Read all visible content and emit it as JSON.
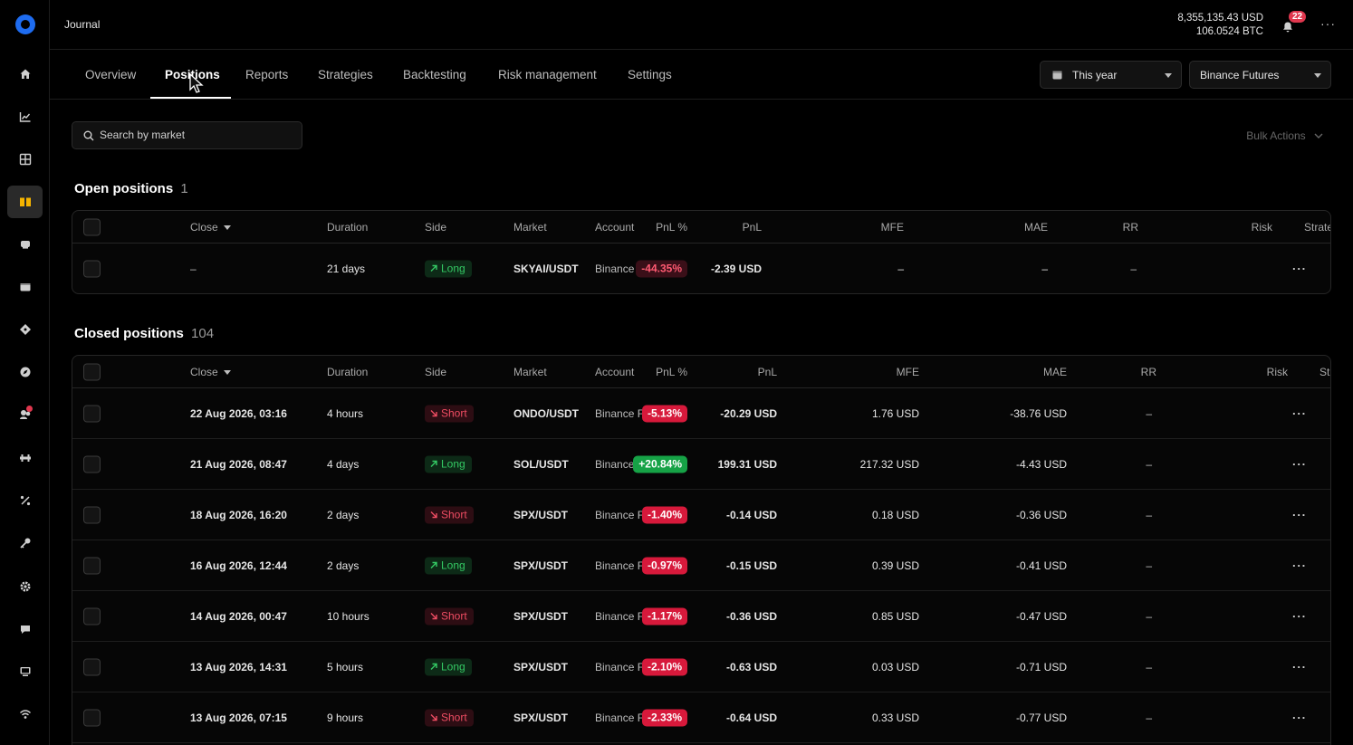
{
  "app": {
    "title": "Journal"
  },
  "balances": {
    "usd": "8,355,135.43 USD",
    "btc": "106.0524 BTC"
  },
  "notifications": {
    "count": "22"
  },
  "sidebar": {
    "items": [
      {
        "icon": "home-icon"
      },
      {
        "icon": "chart-icon"
      },
      {
        "icon": "grid-icon"
      },
      {
        "icon": "journal-icon",
        "active": true
      },
      {
        "icon": "trading-icon"
      },
      {
        "icon": "wallet-icon"
      },
      {
        "icon": "tag-icon"
      },
      {
        "icon": "compass-icon"
      },
      {
        "icon": "community-icon",
        "dot": true
      },
      {
        "icon": "bridge-icon"
      },
      {
        "icon": "percent-icon"
      },
      {
        "icon": "key-icon"
      },
      {
        "icon": "settings-icon"
      },
      {
        "icon": "chat-icon"
      },
      {
        "icon": "monitor-icon"
      },
      {
        "icon": "wifi-icon"
      }
    ]
  },
  "tabs": [
    "Overview",
    "Positions",
    "Reports",
    "Strategies",
    "Backtesting",
    "Risk management",
    "Settings"
  ],
  "active_tab": "Positions",
  "filters": {
    "period": "This year",
    "account": "Binance Futures"
  },
  "search": {
    "placeholder": "Search by market"
  },
  "bulk_actions": "Bulk Actions",
  "open_positions": {
    "title": "Open positions",
    "count": "1",
    "columns": [
      "Close",
      "Duration",
      "Side",
      "Market",
      "Account",
      "PnL %",
      "PnL",
      "MFE",
      "MAE",
      "RR",
      "Risk",
      "Strate"
    ],
    "rows": [
      {
        "close": "–",
        "duration": "21 days",
        "side": "Long",
        "market": "SKYAI/USDT",
        "account": "Binance Futures",
        "pnl_pct": "-44.35%",
        "pnl": "-2.39 USD",
        "mfe": "–",
        "mae": "–",
        "rr": "–"
      }
    ]
  },
  "closed_positions": {
    "title": "Closed positions",
    "count": "104",
    "columns": [
      "Close",
      "Duration",
      "Side",
      "Market",
      "Account",
      "PnL %",
      "PnL",
      "MFE",
      "MAE",
      "RR",
      "Risk",
      "Str"
    ],
    "rows": [
      {
        "close": "22 Aug 2026, 03:16",
        "duration": "4 hours",
        "side": "Short",
        "market": "ONDO/USDT",
        "account": "Binance Futures",
        "pnl_pct": "-5.13%",
        "pnl": "-20.29 USD",
        "mfe": "1.76 USD",
        "mae": "-38.76 USD",
        "rr": "–"
      },
      {
        "close": "21 Aug 2026, 08:47",
        "duration": "4 days",
        "side": "Long",
        "market": "SOL/USDT",
        "account": "Binance Futures",
        "pnl_pct": "+20.84%",
        "pnl": "199.31 USD",
        "mfe": "217.32 USD",
        "mae": "-4.43 USD",
        "rr": "–"
      },
      {
        "close": "18 Aug 2026, 16:20",
        "duration": "2 days",
        "side": "Short",
        "market": "SPX/USDT",
        "account": "Binance Futures",
        "pnl_pct": "-1.40%",
        "pnl": "-0.14 USD",
        "mfe": "0.18 USD",
        "mae": "-0.36 USD",
        "rr": "–"
      },
      {
        "close": "16 Aug 2026, 12:44",
        "duration": "2 days",
        "side": "Long",
        "market": "SPX/USDT",
        "account": "Binance Futures",
        "pnl_pct": "-0.97%",
        "pnl": "-0.15 USD",
        "mfe": "0.39 USD",
        "mae": "-0.41 USD",
        "rr": "–"
      },
      {
        "close": "14 Aug 2026, 00:47",
        "duration": "10 hours",
        "side": "Short",
        "market": "SPX/USDT",
        "account": "Binance Futures",
        "pnl_pct": "-1.17%",
        "pnl": "-0.36 USD",
        "mfe": "0.85 USD",
        "mae": "-0.47 USD",
        "rr": "–"
      },
      {
        "close": "13 Aug 2026, 14:31",
        "duration": "5 hours",
        "side": "Long",
        "market": "SPX/USDT",
        "account": "Binance Futures",
        "pnl_pct": "-2.10%",
        "pnl": "-0.63 USD",
        "mfe": "0.03 USD",
        "mae": "-0.71 USD",
        "rr": "–"
      },
      {
        "close": "13 Aug 2026, 07:15",
        "duration": "9 hours",
        "side": "Short",
        "market": "SPX/USDT",
        "account": "Binance Futures",
        "pnl_pct": "-2.33%",
        "pnl": "-0.64 USD",
        "mfe": "0.33 USD",
        "mae": "-0.77 USD",
        "rr": "–"
      }
    ]
  },
  "colors": {
    "long": "#34c964",
    "short": "#ef4d63",
    "pct_negative": "#d7193b",
    "pct_positive": "#16a246",
    "accent": "#1e6cf0"
  }
}
